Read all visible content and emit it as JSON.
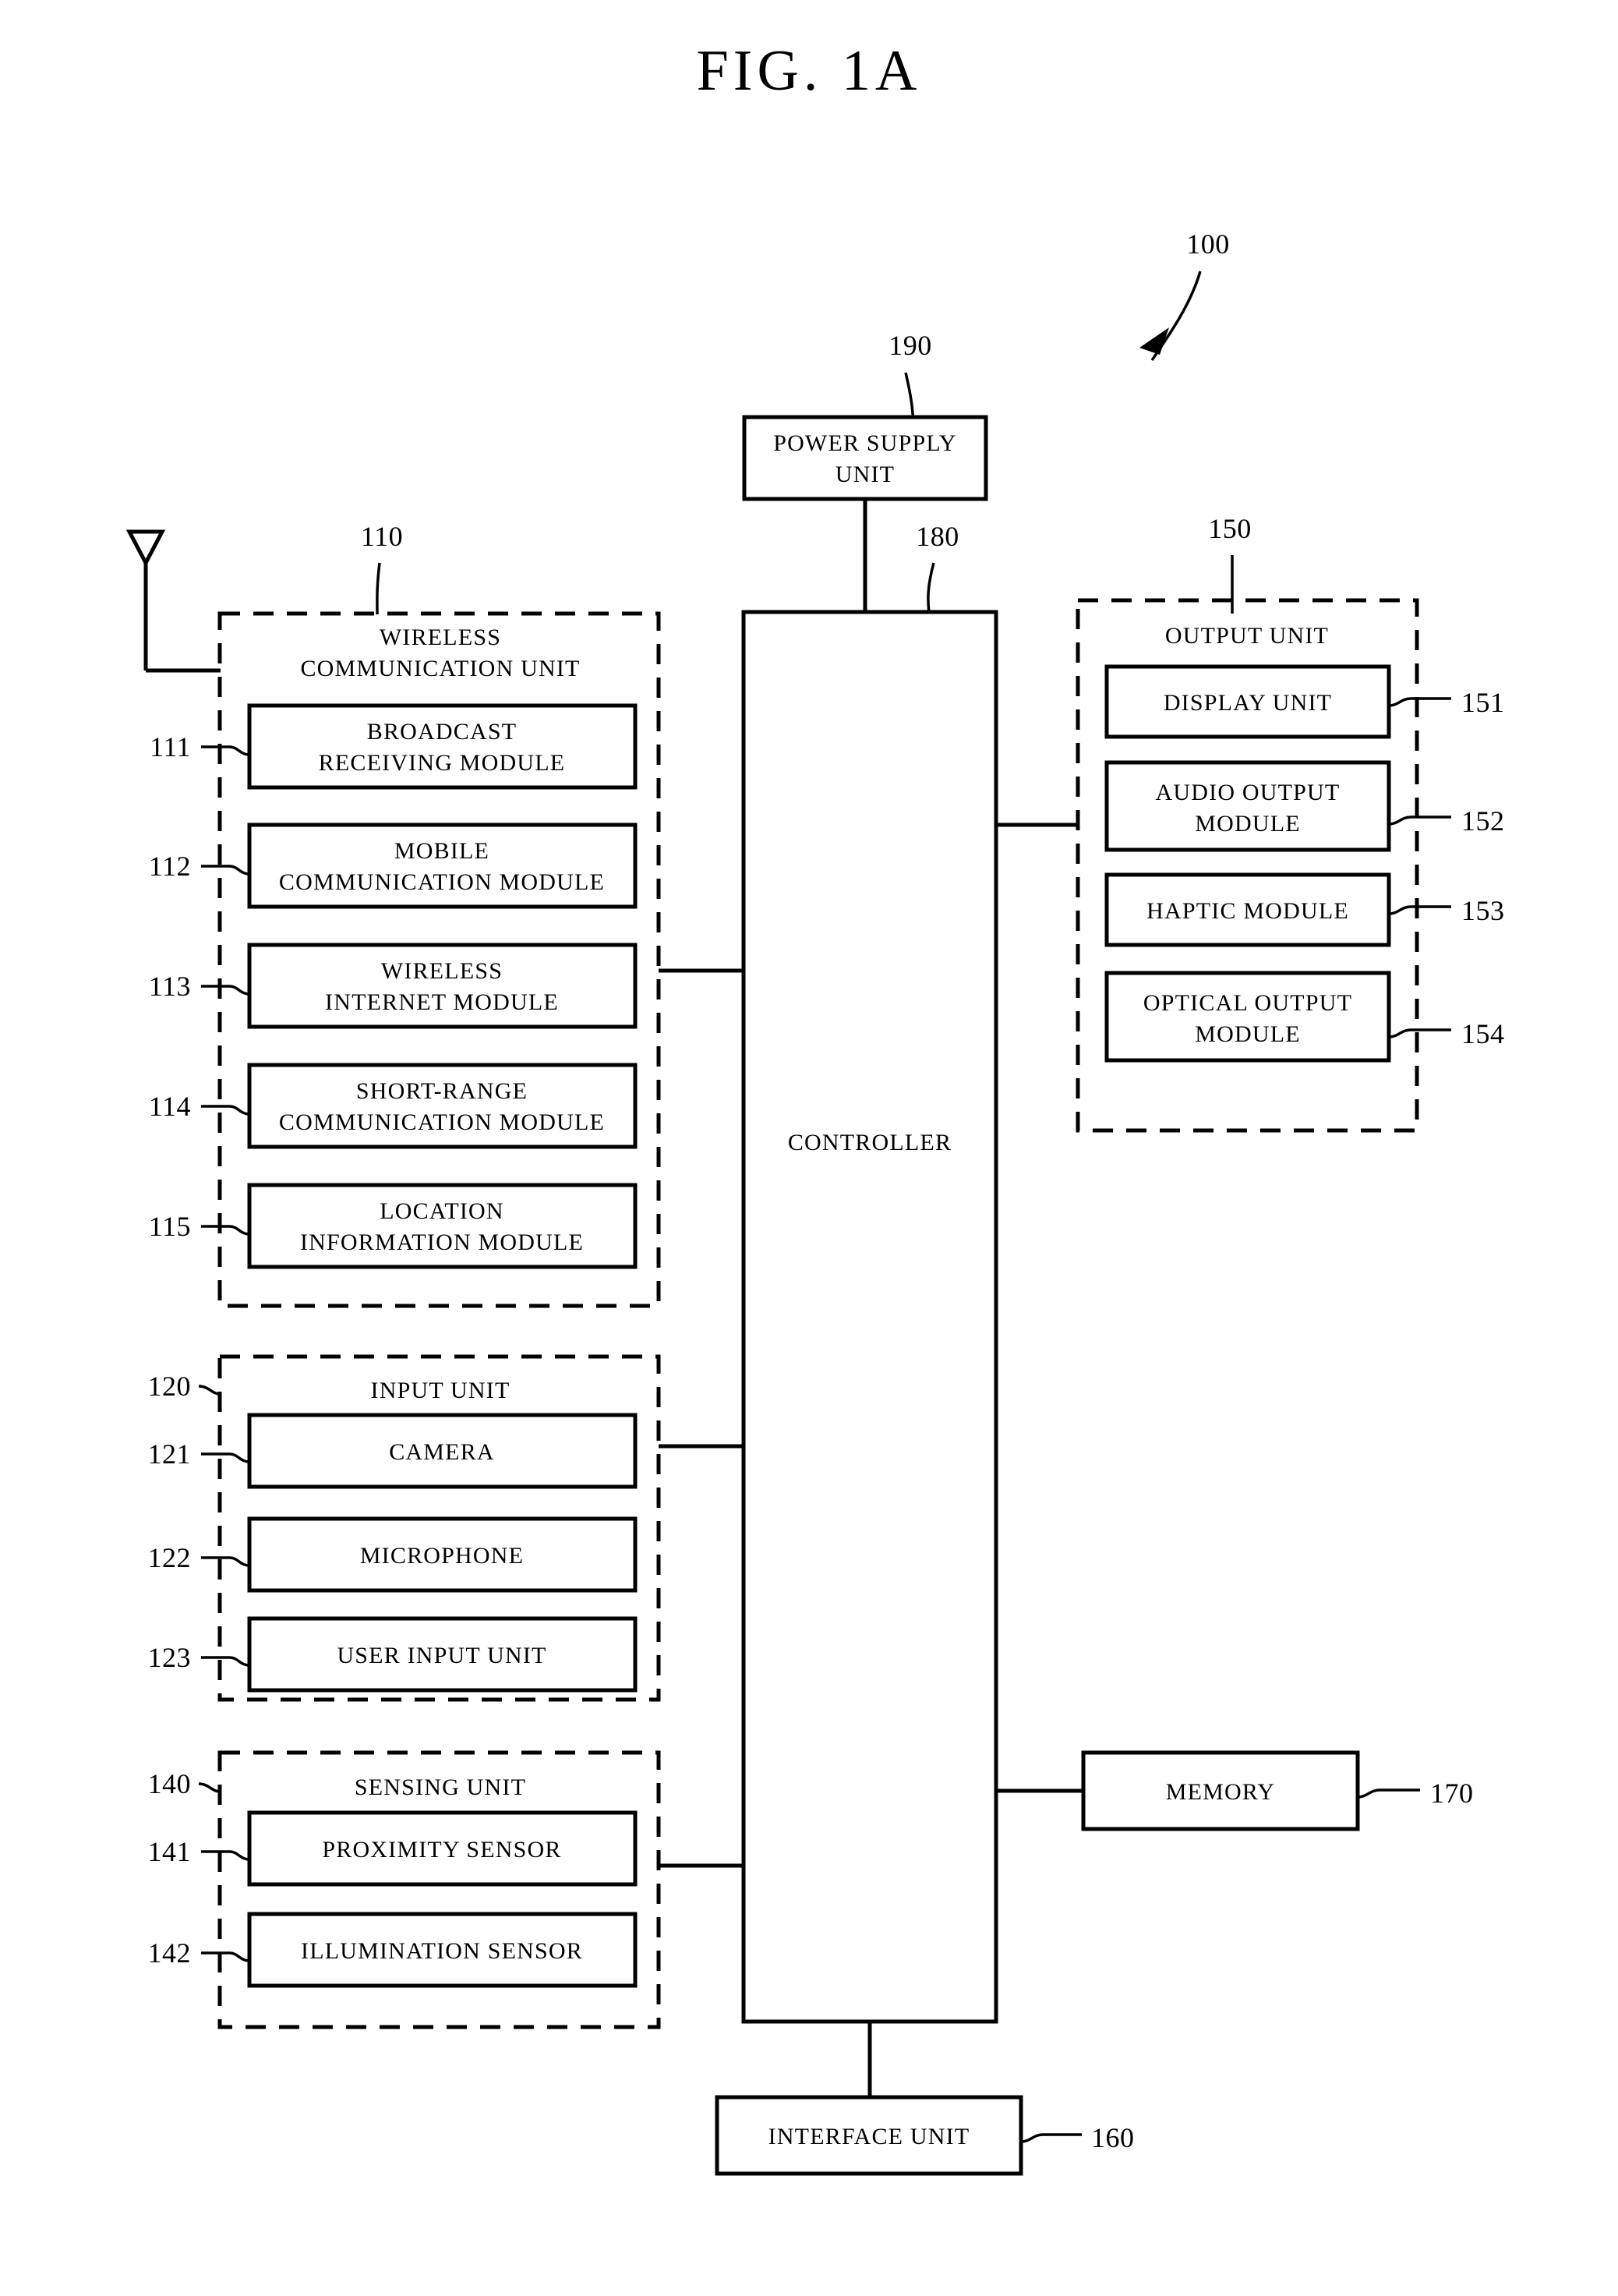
{
  "figure": {
    "title": "FIG. 1A",
    "device_ref": "100"
  },
  "power_supply": {
    "label_line1": "POWER SUPPLY",
    "label_line2": "UNIT",
    "ref": "190"
  },
  "controller": {
    "label": "CONTROLLER",
    "ref": "180"
  },
  "wireless_unit": {
    "title_line1": "WIRELESS",
    "title_line2": "COMMUNICATION UNIT",
    "ref": "110",
    "modules": [
      {
        "ref": "111",
        "line1": "BROADCAST",
        "line2": "RECEIVING MODULE"
      },
      {
        "ref": "112",
        "line1": "MOBILE",
        "line2": "COMMUNICATION MODULE"
      },
      {
        "ref": "113",
        "line1": "WIRELESS",
        "line2": "INTERNET MODULE"
      },
      {
        "ref": "114",
        "line1": "SHORT-RANGE",
        "line2": "COMMUNICATION MODULE"
      },
      {
        "ref": "115",
        "line1": "LOCATION",
        "line2": "INFORMATION MODULE"
      }
    ]
  },
  "input_unit": {
    "title": "INPUT UNIT",
    "ref": "120",
    "modules": [
      {
        "ref": "121",
        "line1": "CAMERA",
        "line2": ""
      },
      {
        "ref": "122",
        "line1": "MICROPHONE",
        "line2": ""
      },
      {
        "ref": "123",
        "line1": "USER INPUT UNIT",
        "line2": ""
      }
    ]
  },
  "sensing_unit": {
    "title": "SENSING UNIT",
    "ref": "140",
    "modules": [
      {
        "ref": "141",
        "line1": "PROXIMITY SENSOR",
        "line2": ""
      },
      {
        "ref": "142",
        "line1": "ILLUMINATION SENSOR",
        "line2": ""
      }
    ]
  },
  "output_unit": {
    "title": "OUTPUT UNIT",
    "ref": "150",
    "modules": [
      {
        "ref": "151",
        "line1": "DISPLAY UNIT",
        "line2": ""
      },
      {
        "ref": "152",
        "line1": "AUDIO OUTPUT",
        "line2": "MODULE"
      },
      {
        "ref": "153",
        "line1": "HAPTIC MODULE",
        "line2": ""
      },
      {
        "ref": "154",
        "line1": "OPTICAL OUTPUT",
        "line2": "MODULE"
      }
    ]
  },
  "memory": {
    "label": "MEMORY",
    "ref": "170"
  },
  "interface_unit": {
    "label": "INTERFACE UNIT",
    "ref": "160"
  },
  "icons": {
    "antenna": "antenna-icon",
    "arrow": "device-pointer-arrow-icon"
  },
  "colors": {
    "ink": "#000000",
    "paper": "#ffffff"
  }
}
